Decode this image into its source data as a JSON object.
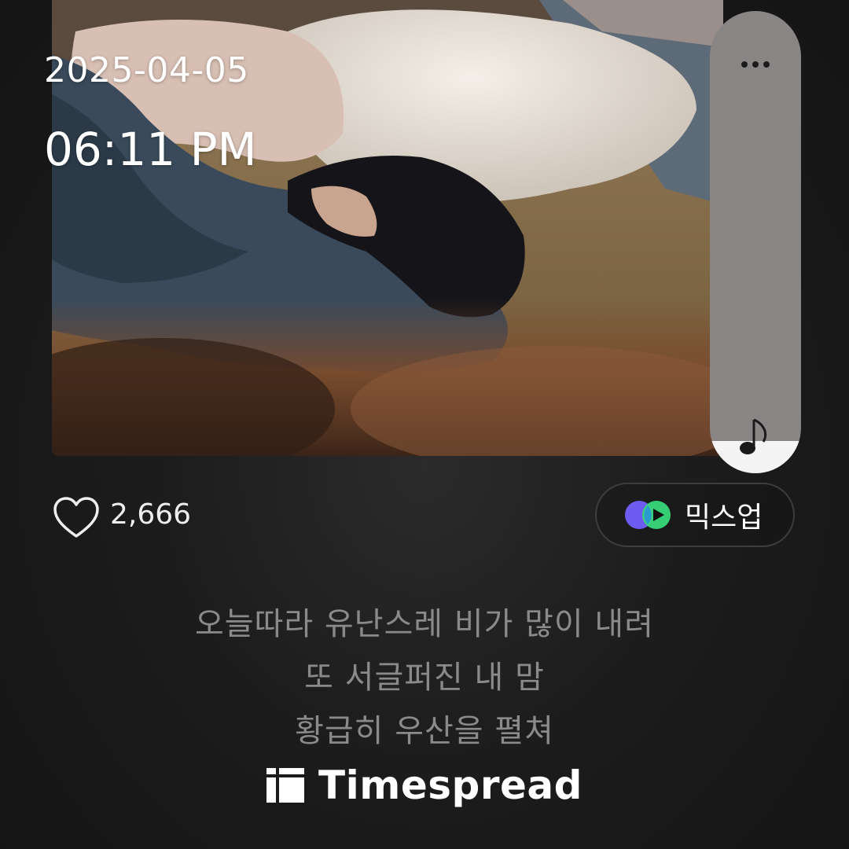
{
  "overlay": {
    "date": "2025-04-05",
    "time": "06:11 PM"
  },
  "player": {
    "more_icon": "more-horizontal-icon",
    "music_icon": "music-note-icon",
    "progress_fraction": 0.07,
    "panel_color": "#8a8585",
    "fill_color": "#f4f4f4"
  },
  "reactions": {
    "like_icon": "heart-outline-icon",
    "like_count": "2,666"
  },
  "mixup": {
    "label": "믹스업",
    "icon": "mixup-play-icon"
  },
  "lyrics": [
    "오늘따라 유난스레 비가 많이 내려",
    "또 서글퍼진 내 맘",
    "황급히 우산을 펼쳐"
  ],
  "brand": {
    "name": "Timespread"
  }
}
